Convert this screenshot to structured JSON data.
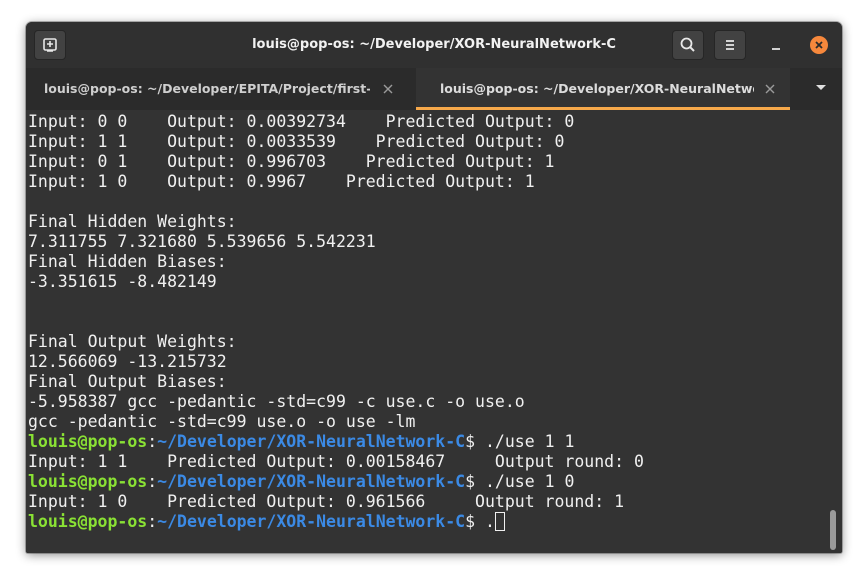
{
  "window": {
    "title": "louis@pop-os: ~/Developer/XOR-NeuralNetwork-C"
  },
  "titlebar": {
    "new_tab_icon": "new-tab-icon",
    "search_icon": "search-icon",
    "menu_icon": "hamburger-menu-icon",
    "minimize_icon": "minimize-icon",
    "close_icon": "close-icon",
    "close_color": "#f6883c"
  },
  "tabs": [
    {
      "label": "louis@pop-os: ~/Developer/EPITA/Project/first-de...",
      "active": false
    },
    {
      "label": "louis@pop-os: ~/Developer/XOR-NeuralNetwork-C",
      "active": true
    }
  ],
  "tabbar": {
    "menu_icon": "chevron-down-icon",
    "accent": "#f6a84a"
  },
  "terminal": {
    "lines": [
      "Input: 0 0    Output: 0.00392734    Predicted Output: 0",
      "Input: 1 1    Output: 0.0033539    Predicted Output: 0",
      "Input: 0 1    Output: 0.996703    Predicted Output: 1",
      "Input: 1 0    Output: 0.9967    Predicted Output: 1",
      "",
      "Final Hidden Weights:",
      "7.311755 7.321680 5.539656 5.542231",
      "Final Hidden Biases:",
      "-3.351615 -8.482149",
      "",
      "",
      "Final Output Weights:",
      "12.566069 -13.215732",
      "Final Output Biases:",
      "-5.958387 gcc -pedantic -std=c99 -c use.c -o use.o",
      "gcc -pedantic -std=c99 use.o -o use -lm"
    ],
    "prompt_user": "louis@pop-os",
    "prompt_sep": ":",
    "prompt_path": "~/Developer/XOR-NeuralNetwork-C",
    "prompt_symbol": "$ ",
    "cmd1": "./use 1 1",
    "out1": "Input: 1 1    Predicted Output: 0.00158467     Output round: 0",
    "cmd2": "./use 1 0",
    "out2": "Input: 1 0    Predicted Output: 0.961566     Output round: 1",
    "cmd3": ".",
    "colors": {
      "user": "#8ae234",
      "path": "#3b8ae5",
      "text": "#f0f0f0",
      "background": "#333333"
    }
  }
}
